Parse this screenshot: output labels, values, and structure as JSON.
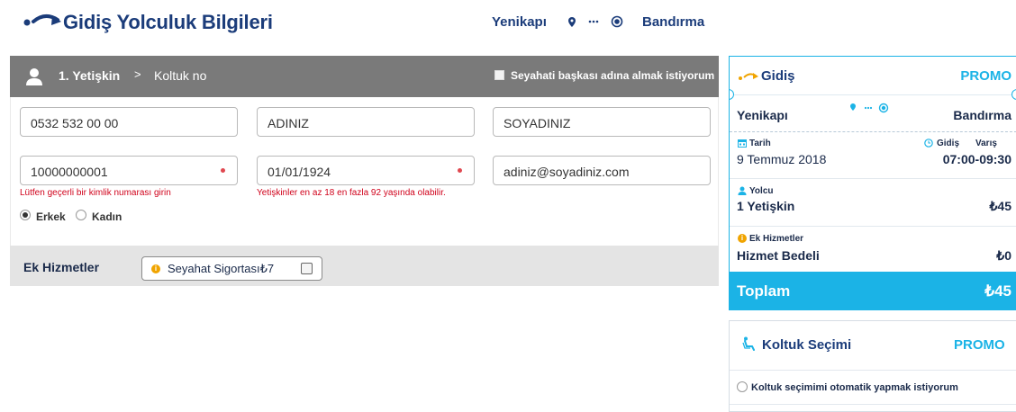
{
  "header": {
    "title": "Gidiş Yolculuk Bilgileri",
    "from": "Yenikapı",
    "to": "Bandırma"
  },
  "passenger": {
    "title": "1. Yetişkin",
    "chevron": ">",
    "seat_label": "Koltuk no",
    "other_person_label": "Seyahati başkası adına almak istiyorum",
    "phone": "0532 532 00 00",
    "first_name_placeholder": "ADINIZ",
    "last_name_placeholder": "SOYADINIZ",
    "id_number": "10000000001",
    "id_error": "Lütfen geçerli bir kimlik numarası girin",
    "birth_date": "01/01/1924",
    "birth_error": "Yetişkinler en az 18 en fazla 92 yaşında olabilir.",
    "email": "adiniz@soyadiniz.com",
    "gender_male": "Erkek",
    "gender_female": "Kadın",
    "selected_gender": "Erkek"
  },
  "extras": {
    "title": "Ek Hizmetler",
    "insurance_label": "Seyahat Sigortası₺7",
    "info_glyph": "i"
  },
  "summary": {
    "title": "Gidiş",
    "promo": "PROMO",
    "from": "Yenikapı",
    "to": "Bandırma",
    "date_label": "Tarih",
    "date": "9 Temmuz 2018",
    "departure_label": "Gidiş",
    "arrival_label": "Varış",
    "times": "07:00-09:30",
    "passenger_label": "Yolcu",
    "passenger_value": "1 Yetişkin",
    "passenger_price": "₺45",
    "extras_label": "Ek Hizmetler",
    "service_label": "Hizmet Bedeli",
    "service_price": "₺0",
    "total_label": "Toplam",
    "total_price": "₺45",
    "info_glyph": "i"
  },
  "seat_selection": {
    "title": "Koltuk Seçimi",
    "promo": "PROMO",
    "auto_label": "Koltuk seçimimi otomatik yapmak istiyorum"
  },
  "colors": {
    "navy": "#1b3c7a",
    "accent": "#1bb3e6",
    "error": "#d0021b",
    "info": "#f0a400",
    "panel_gray": "#7a7a7a"
  }
}
